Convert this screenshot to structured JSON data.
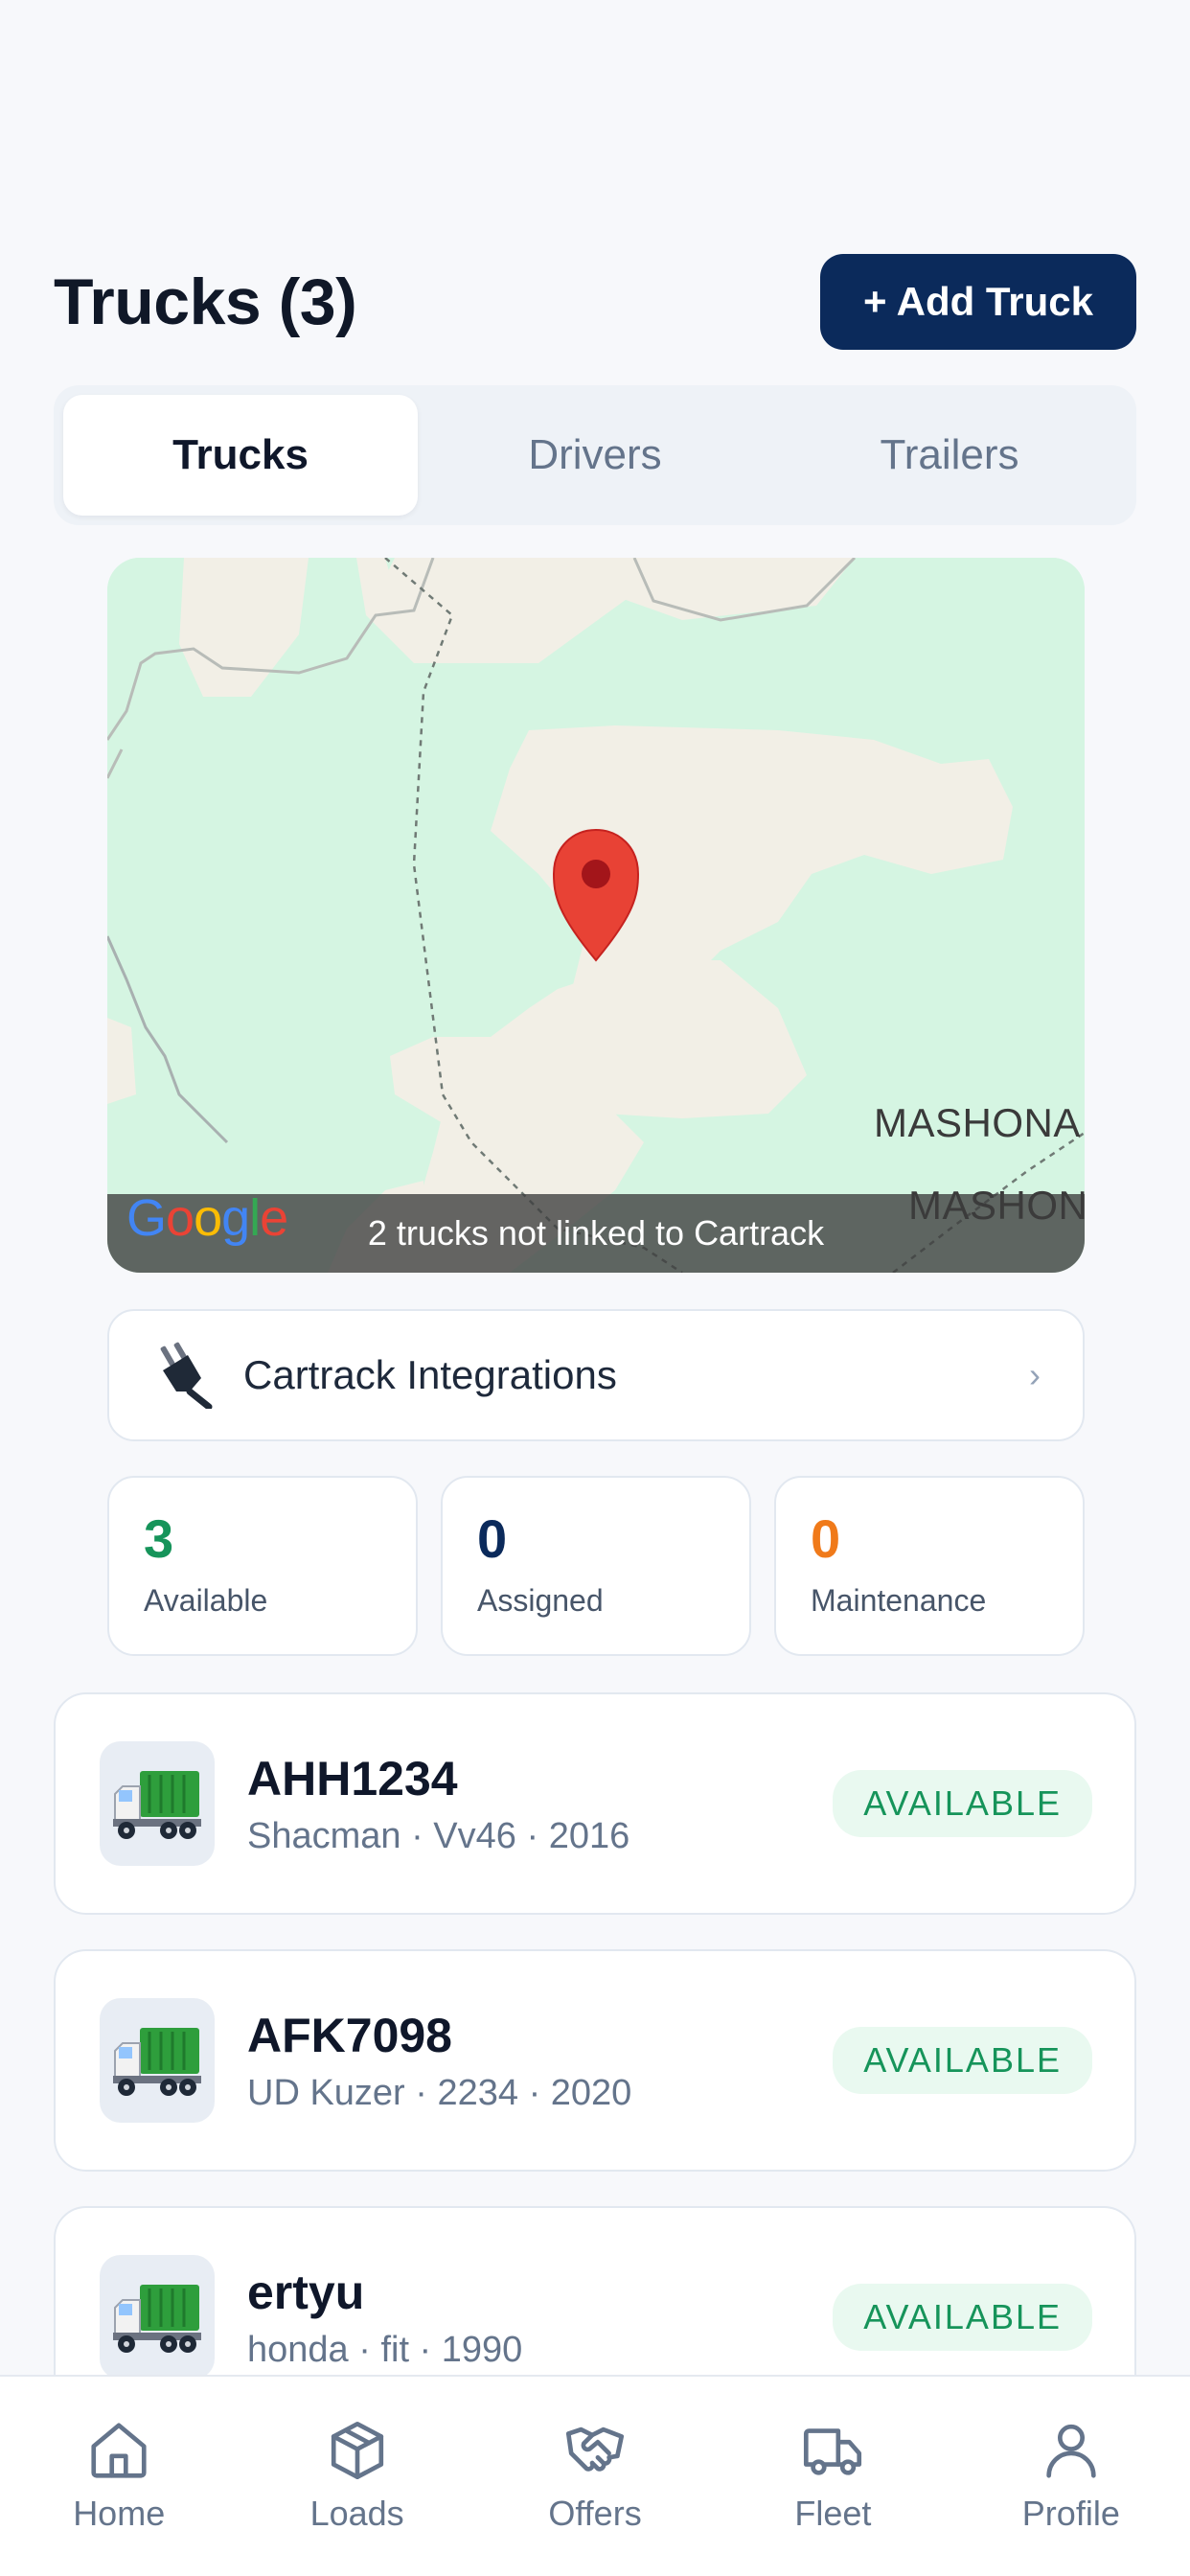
{
  "header": {
    "title": "Trucks (3)",
    "add_button": "+ Add Truck"
  },
  "segments": [
    {
      "label": "Trucks",
      "active": true
    },
    {
      "label": "Drivers",
      "active": false
    },
    {
      "label": "Trailers",
      "active": false
    }
  ],
  "map": {
    "banner": "2 trucks not linked to Cartrack",
    "logo_text": "Google",
    "place_labels": [
      "MASHONA",
      "MASHON"
    ],
    "pin_icon": "map-pin-icon"
  },
  "integration": {
    "label": "Cartrack Integrations",
    "icon": "plug-icon",
    "chevron": "›"
  },
  "stats": [
    {
      "value": "3",
      "label": "Available",
      "color": "#16945a"
    },
    {
      "value": "0",
      "label": "Assigned",
      "color": "#0b2a5b"
    },
    {
      "value": "0",
      "label": "Maintenance",
      "color": "#f07a1a"
    }
  ],
  "trucks": [
    {
      "plate": "AHH1234",
      "details": "Shacman · Vv46 · 2016",
      "status": "AVAILABLE"
    },
    {
      "plate": "AFK7098",
      "details": "UD Kuzer · 2234 · 2020",
      "status": "AVAILABLE"
    },
    {
      "plate": "ertyu",
      "details": "honda · fit · 1990",
      "status": "AVAILABLE"
    }
  ],
  "tabbar": [
    {
      "label": "Home",
      "icon": "home-icon"
    },
    {
      "label": "Loads",
      "icon": "box-icon"
    },
    {
      "label": "Offers",
      "icon": "handshake-icon"
    },
    {
      "label": "Fleet",
      "icon": "truck-icon"
    },
    {
      "label": "Profile",
      "icon": "user-icon"
    }
  ]
}
